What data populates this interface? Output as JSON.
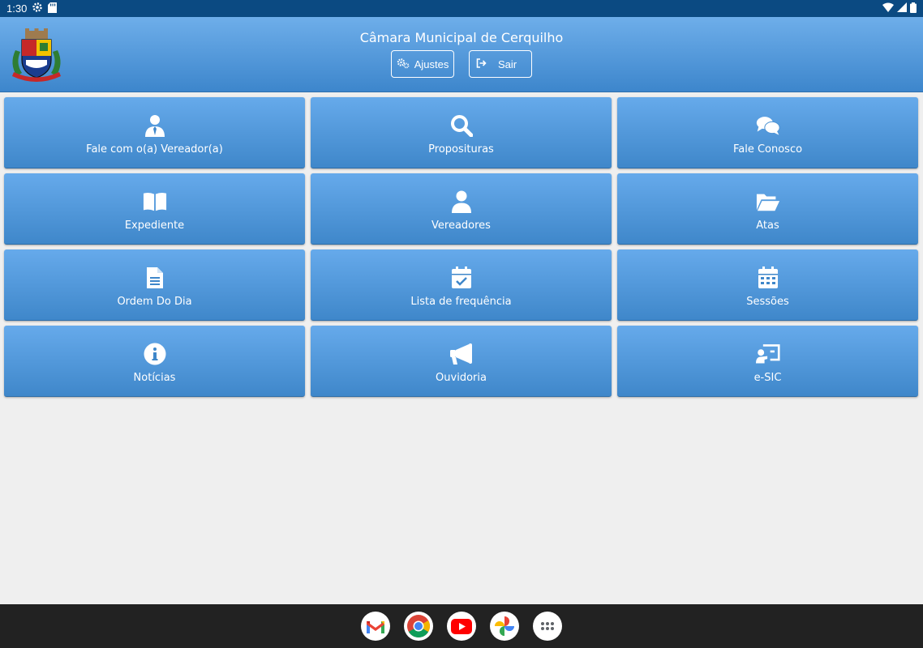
{
  "status_bar": {
    "time": "1:30"
  },
  "header": {
    "title": "Câmara Municipal de Cerquilho",
    "buttons": {
      "settings": "Ajustes",
      "logout": "Sair"
    }
  },
  "tiles": [
    {
      "label": "Fale com o(a) Vereador(a)",
      "icon": "user-tie-icon"
    },
    {
      "label": "Proposituras",
      "icon": "search-icon"
    },
    {
      "label": "Fale Conosco",
      "icon": "chat-bubbles-icon"
    },
    {
      "label": "Expediente",
      "icon": "book-open-icon"
    },
    {
      "label": "Vereadores",
      "icon": "user-icon"
    },
    {
      "label": "Atas",
      "icon": "folder-open-icon"
    },
    {
      "label": "Ordem Do Dia",
      "icon": "document-icon"
    },
    {
      "label": "Lista de frequência",
      "icon": "calendar-check-icon"
    },
    {
      "label": "Sessões",
      "icon": "calendar-icon"
    },
    {
      "label": "Notícias",
      "icon": "info-circle-icon"
    },
    {
      "label": "Ouvidoria",
      "icon": "megaphone-icon"
    },
    {
      "label": "e-SIC",
      "icon": "presentation-icon"
    }
  ],
  "dock": [
    "gmail-icon",
    "chrome-icon",
    "youtube-icon",
    "photos-icon",
    "app-drawer-icon"
  ],
  "colors": {
    "status_bar": "#0b4a82",
    "tile_top": "#66aaeb",
    "tile_bottom": "#3f87ca",
    "background": "#efefef"
  }
}
